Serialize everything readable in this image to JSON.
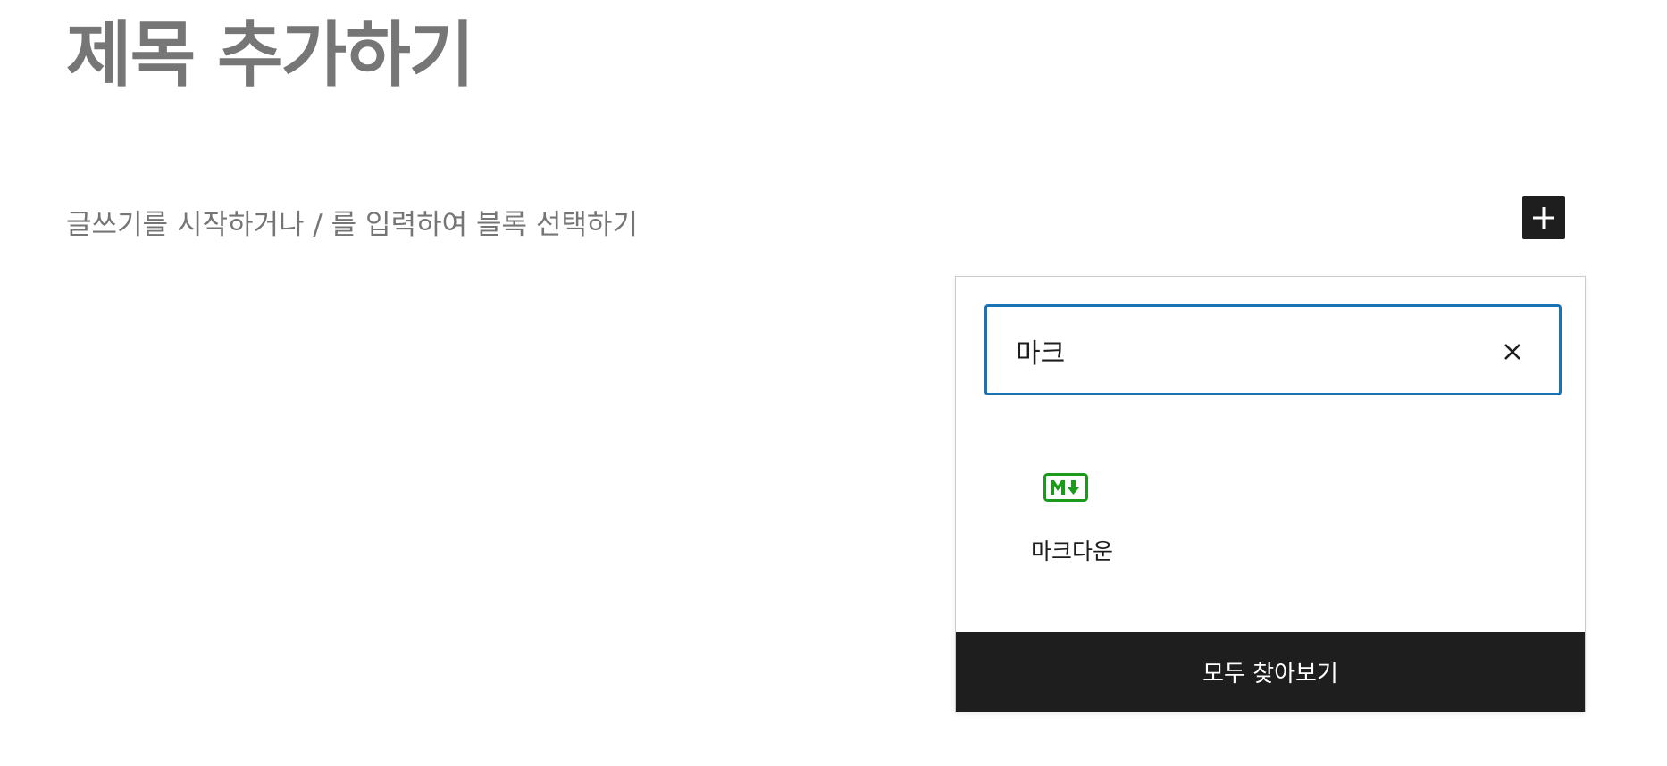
{
  "editor": {
    "title_placeholder": "제목 추가하기",
    "paragraph_placeholder": "글쓰기를 시작하거나 / 를 입력하여 블록 선택하기"
  },
  "inserter": {
    "search_value": "마크",
    "search_icons": {
      "clear": "close-icon"
    },
    "results": [
      {
        "label": "마크다운",
        "icon": "markdown-icon",
        "icon_color": "#1a9c1a"
      }
    ],
    "browse_all_label": "모두 찾아보기"
  },
  "colors": {
    "accent": "#1a73b5",
    "dark": "#1e1e1e",
    "placeholder": "#767676"
  }
}
